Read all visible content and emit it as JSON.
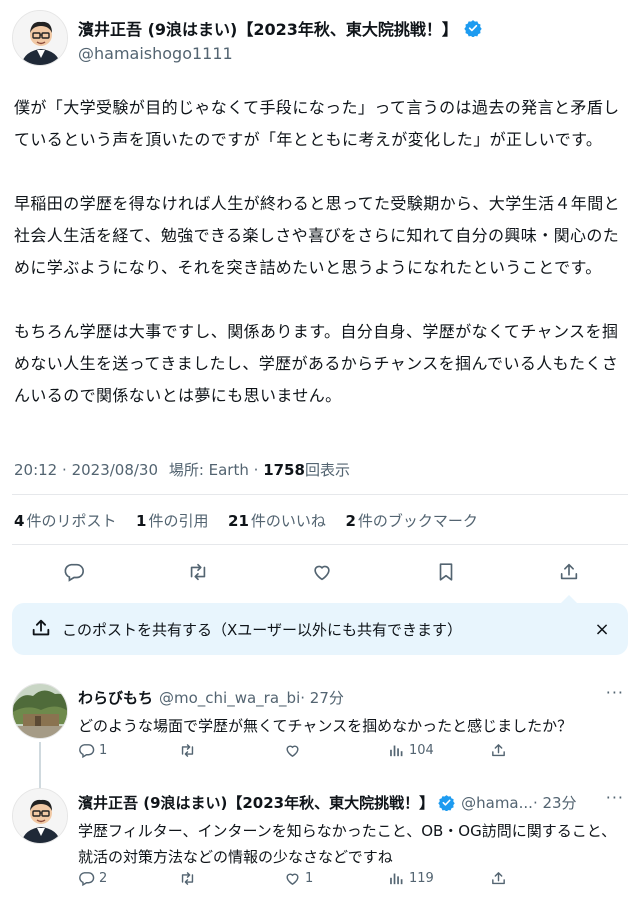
{
  "author": {
    "display_name": "濱井正吾 (9浪はまい)【2023年秋、東大院挑戦！】",
    "handle": "@hamaishogo1111"
  },
  "tweet": {
    "text": "僕が「大学受験が目的じゃなくて手段になった」って言うのは過去の発言と矛盾しているという声を頂いたのですが「年とともに考えが変化した」が正しいです。\n\n早稲田の学歴を得なければ人生が終わると思ってた受験期から、大学生活４年間と社会人生活を経て、勉強できる楽しさや喜びをさらに知れて自分の興味・関心のために学ぶようになり、それを突き詰めたいと思うようになれたということです。\n\nもちろん学歴は大事ですし、関係あります。自分自身、学歴がなくてチャンスを掴めない人生を送ってきましたし、学歴があるからチャンスを掴んでいる人もたくさんいるので関係ないとは夢にも思いません。",
    "time": "20:12",
    "date": "2023/08/30",
    "location": "場所: Earth",
    "views": "1758",
    "views_label": "回表示"
  },
  "stats": {
    "reposts_num": "4",
    "reposts_label": "件のリポスト",
    "quotes_num": "1",
    "quotes_label": "件の引用",
    "likes_num": "21",
    "likes_label": "件のいいね",
    "bookmarks_num": "2",
    "bookmarks_label": "件のブックマーク"
  },
  "actions": {
    "icons": [
      "reply-icon",
      "repost-icon",
      "like-icon",
      "bookmark-icon",
      "share-icon"
    ]
  },
  "share_banner": {
    "text": "このポストを共有する（Xユーザー以外にも共有できます）",
    "close": "×"
  },
  "replies": [
    {
      "name": "わらびもち",
      "handle": "@mo_chi_wa_ra_bi",
      "time": "· 27分",
      "more": "···",
      "text": "どのような場面で学歴が無くてチャンスを掴めなかったと感じましたか？",
      "reply_count": "1",
      "repost_count": "",
      "like_count": "",
      "views": "104"
    },
    {
      "name": "濱井正吾 (9浪はまい)【2023年秋、東大院挑戦！】",
      "handle": "@hama...",
      "time": "· 23分",
      "more": "···",
      "text": "学歴フィルター、インターンを知らなかったこと、OB・OG訪問に関すること、就活の対策方法などの情報の少なさなどですね",
      "reply_count": "2",
      "repost_count": "",
      "like_count": "1",
      "views": "119"
    }
  ],
  "colors": {
    "accent": "#1d9bf0",
    "secondary_text": "#536471",
    "share_banner_bg": "#e8f5fd"
  }
}
